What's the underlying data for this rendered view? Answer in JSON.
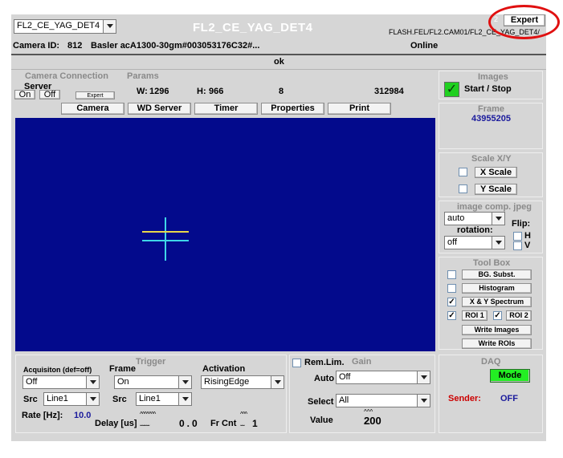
{
  "header": {
    "camera_select": "FL2_CE_YAG_DET4",
    "title": "FL2_CE_YAG_DET4",
    "expert_count": "2",
    "expert_button": "Expert",
    "camera_path": "FLASH.FEL/FL2.CAM01/FL2_CE_YAG_DET4/"
  },
  "camera_info": {
    "id_label": "Camera ID:",
    "id_value": "812",
    "model": "Basler acA1300-30gm#003053176C32#...",
    "status": "Online"
  },
  "status_bar": "ok",
  "camera_connection": {
    "title": "Camera Connection",
    "server_label": "Server",
    "on": "On",
    "off": "Off",
    "expert": "Expert"
  },
  "params": {
    "title": "Params",
    "w_label": "W:",
    "w_value": "1296",
    "h_label": "H:",
    "h_value": "966",
    "bits": "8",
    "size": "312984"
  },
  "tabs": [
    "Camera",
    "WD Server",
    "Timer",
    "Properties",
    "Print"
  ],
  "images": {
    "title": "Images",
    "start_stop": "Start / Stop"
  },
  "frame": {
    "title": "Frame",
    "value": "43955205"
  },
  "scale": {
    "title": "Scale X/Y",
    "x": "X Scale",
    "y": "Y Scale"
  },
  "image_comp": {
    "title": "image comp. jpeg",
    "mode": "auto",
    "flip": "Flip:",
    "rotation": "rotation:",
    "rotation_value": "off",
    "h": "H",
    "v": "V"
  },
  "toolbox": {
    "title": "Tool Box",
    "bg": "BG. Subst.",
    "hist": "Histogram",
    "spectrum": "X & Y Spectrum",
    "roi1": "ROI 1",
    "roi2": "ROI 2",
    "write_images": "Write Images",
    "write_rois": "Write ROIs",
    "checks": {
      "bg": "",
      "hist": "",
      "spectrum": "✓",
      "roi1": "✓",
      "roi2": "✓"
    }
  },
  "trigger": {
    "title": "Trigger",
    "acq_label": "Acquisiton (def=off)",
    "acq_value": "Off",
    "frame_label": "Frame",
    "frame_value": "On",
    "activation_label": "Activation",
    "activation_value": "RisingEdge",
    "src_label": "Src",
    "src1": "Line1",
    "src2_label": "Src",
    "src2": "Line1",
    "rate_label": "Rate [Hz]:",
    "rate_value": "10.0",
    "delay_label": "Delay [us]",
    "delay_value": "0.0",
    "frcnt_label": "Fr Cnt",
    "frcnt_value": "1"
  },
  "gain": {
    "remlim": "Rem.Lim.",
    "title": "Gain",
    "auto_label": "Auto",
    "auto_value": "Off",
    "select_label": "Select",
    "select_value": "All",
    "value_label": "Value",
    "value": "200"
  },
  "daq": {
    "title": "DAQ",
    "mode": "Mode",
    "sender_label": "Sender:",
    "sender_value": "OFF"
  },
  "colors": {
    "image_bg": "#030a8c",
    "crosshair_h": "#e8d84a",
    "crosshair_c": "#3fd6e8",
    "accent_blue": "#1a1a9c",
    "sender_red": "#cc0000",
    "mode_green": "#23ee23",
    "annotation_red": "#e01010"
  }
}
